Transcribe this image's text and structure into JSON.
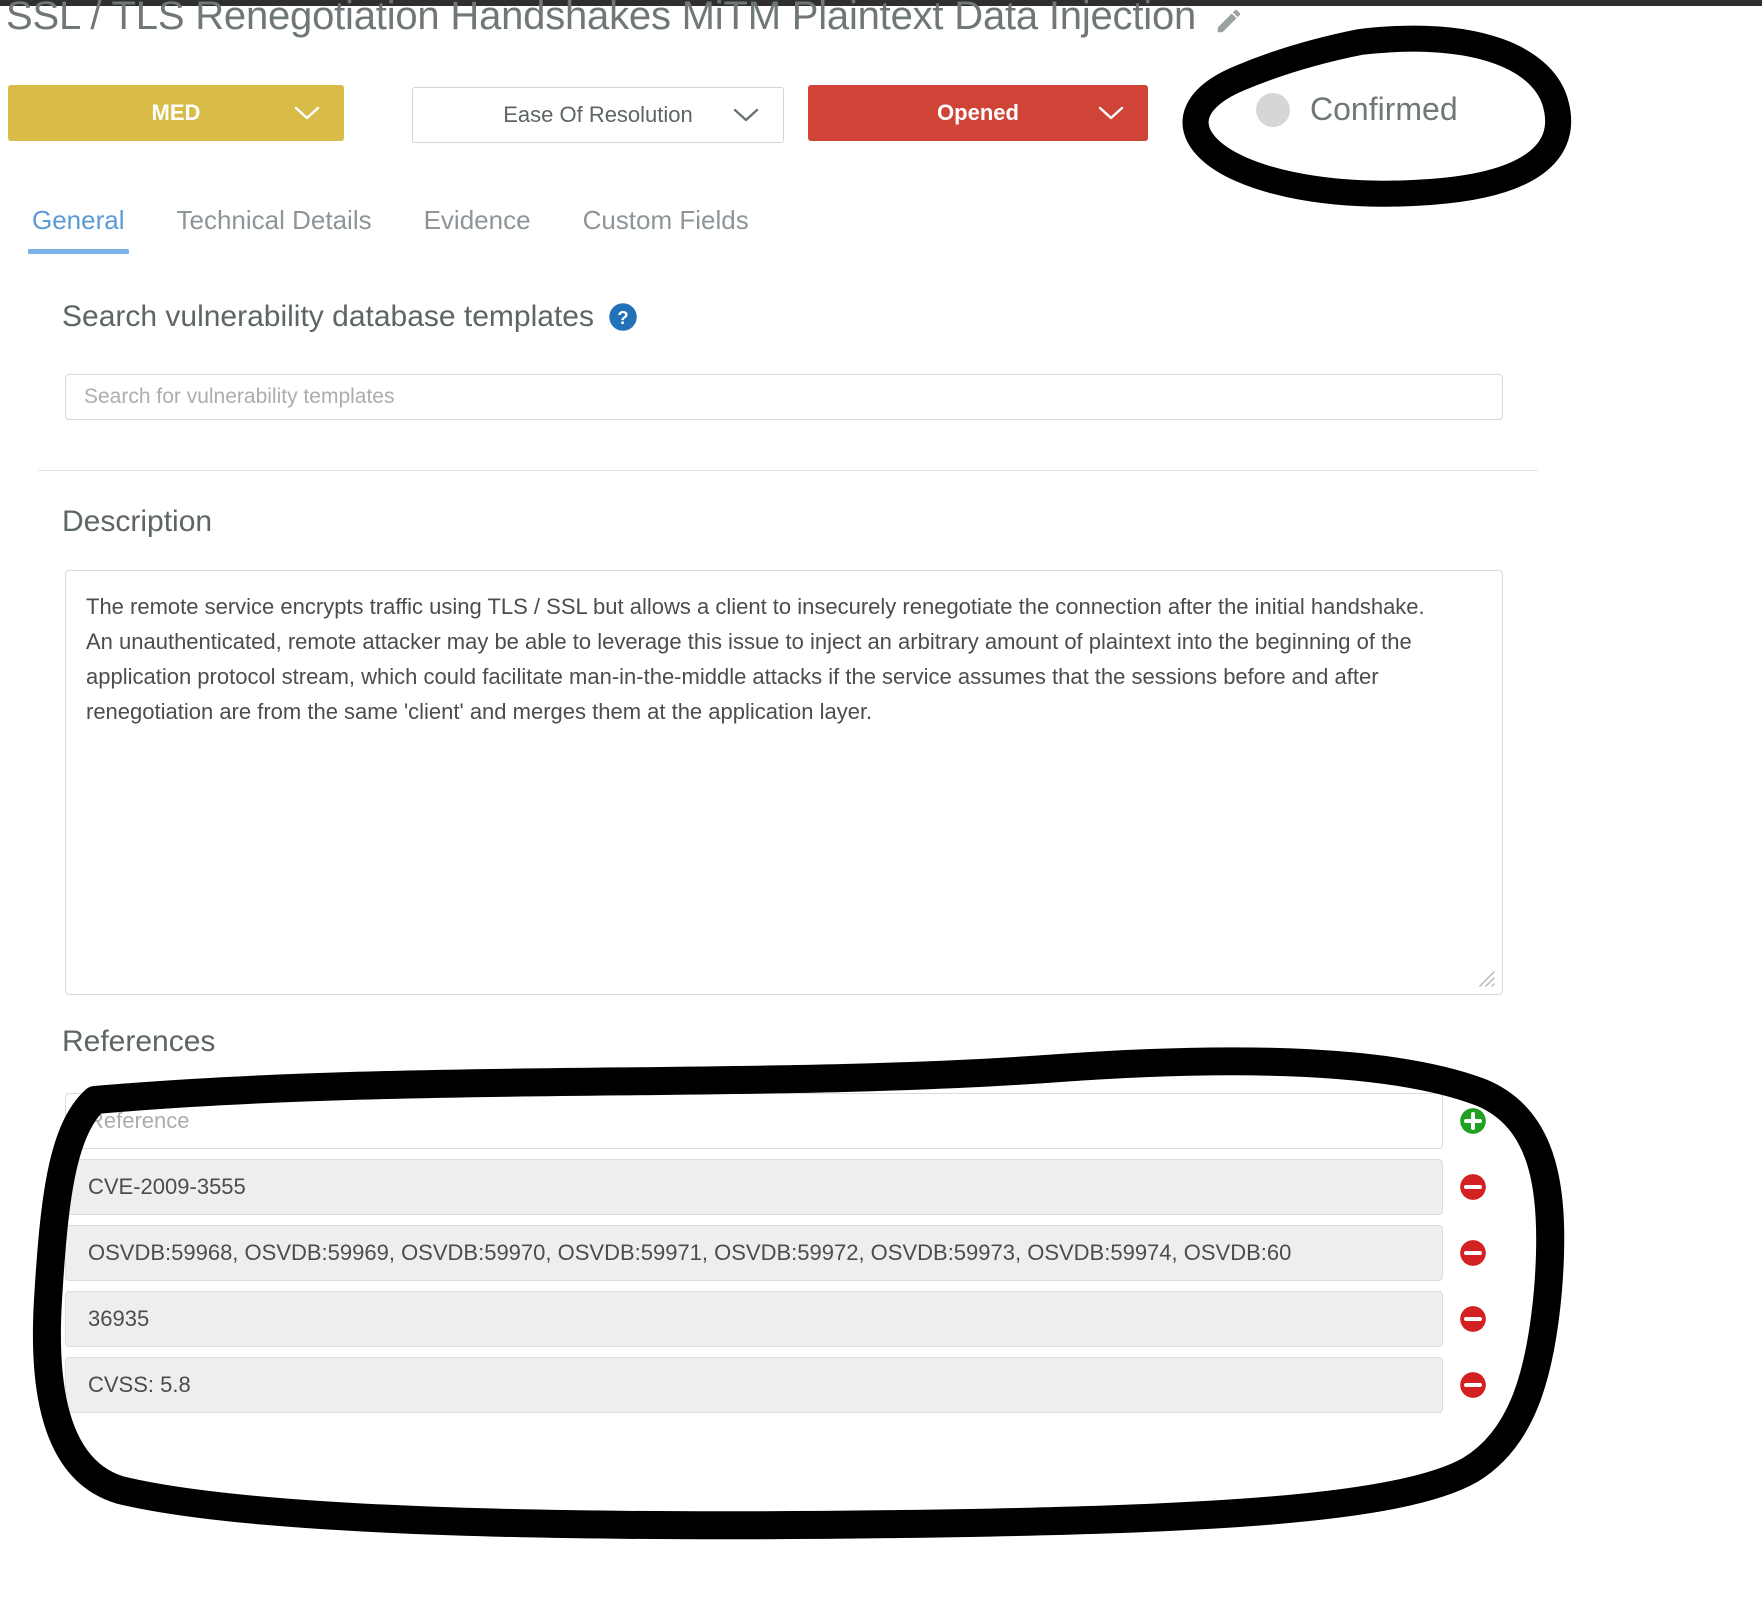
{
  "header": {
    "title": "SSL / TLS Renegotiation Handshakes MiTM Plaintext Data Injection",
    "edit_icon": "pencil-icon"
  },
  "controls": {
    "severity": {
      "value": "MED",
      "color": "#d9bc48",
      "caret": "chevron-down-icon"
    },
    "ease_of_resolution": {
      "value": "Ease Of Resolution",
      "caret": "chevron-down-icon"
    },
    "status": {
      "value": "Opened",
      "color": "#cf4436",
      "caret": "chevron-down-icon"
    },
    "confirmed": {
      "label": "Confirmed",
      "toggle_color": "#d6d6d6",
      "state": "off"
    }
  },
  "tabs": [
    {
      "label": "General",
      "active": true
    },
    {
      "label": "Technical Details",
      "active": false
    },
    {
      "label": "Evidence",
      "active": false
    },
    {
      "label": "Custom Fields",
      "active": false
    }
  ],
  "search": {
    "heading": "Search vulnerability database templates",
    "help_icon": "question-circle-icon",
    "placeholder": "Search for vulnerability templates",
    "value": ""
  },
  "description": {
    "label": "Description",
    "text": "The remote service encrypts traffic using TLS / SSL but allows a client to insecurely renegotiate the connection after the initial handshake.\nAn unauthenticated, remote attacker may be able to leverage this issue to inject an arbitrary amount of plaintext into the beginning of the application protocol stream, which could facilitate man-in-the-middle attacks if the service assumes that the sessions before and after renegotiation are from the same 'client' and merges them at the application layer."
  },
  "references": {
    "label": "References",
    "new_placeholder": "Reference",
    "new_value": "",
    "add_icon": "plus-circle-icon",
    "add_color": "#21a121",
    "remove_icon": "minus-circle-icon",
    "remove_color": "#d32020",
    "items": [
      {
        "value": "CVE-2009-3555"
      },
      {
        "value": "OSVDB:59968, OSVDB:59969, OSVDB:59970, OSVDB:59971, OSVDB:59972, OSVDB:59973, OSVDB:59974, OSVDB:60"
      },
      {
        "value": "36935"
      },
      {
        "value": "CVSS: 5.8"
      }
    ]
  },
  "annotations": [
    {
      "name": "circle-around-confirmed-toggle",
      "shape": "hand-drawn-ellipse",
      "color": "#000000"
    },
    {
      "name": "circle-around-references-list",
      "shape": "hand-drawn-ellipse",
      "color": "#000000"
    }
  ]
}
